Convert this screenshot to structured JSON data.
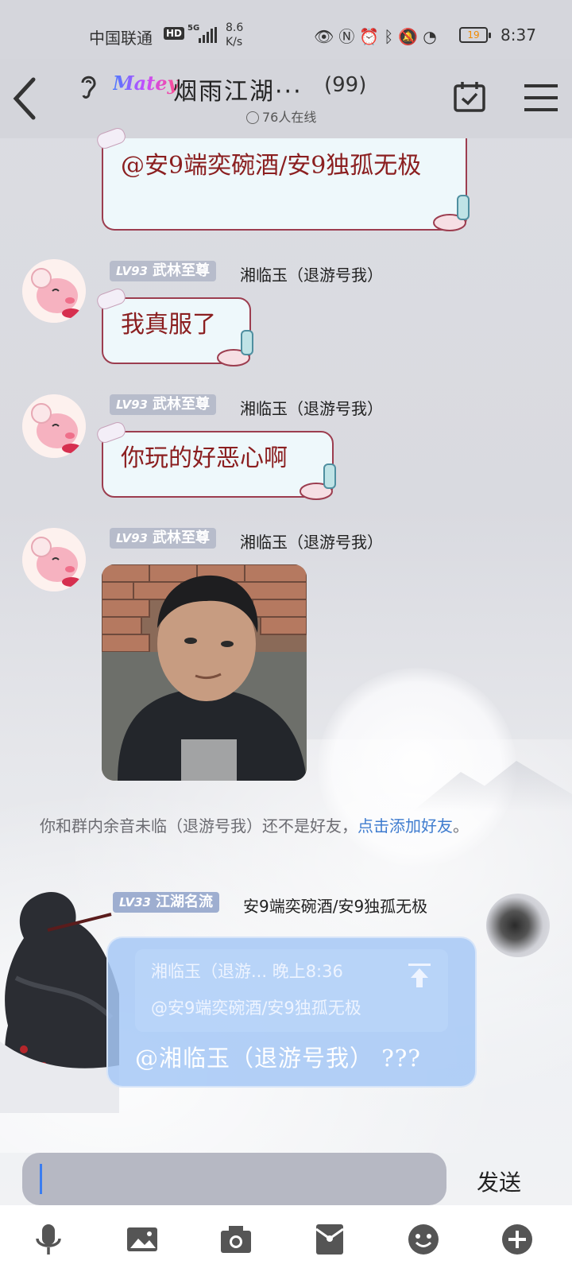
{
  "status_bar": {
    "carrier": "中国联通",
    "hd": "HD",
    "signal_label": "5G",
    "speed_value": "8.6",
    "speed_unit": "K/s",
    "battery": "19",
    "time": "8:37"
  },
  "header": {
    "logo_text": "Matey",
    "title": "烟雨江湖···",
    "member_count": "(99)",
    "online": "76人在线"
  },
  "messages": [
    {
      "text": "@安9端奕碗酒/安9独孤无极"
    },
    {
      "level": "LV93",
      "rank": "武林至尊",
      "sender": "湘临玉（退游号我）",
      "text": "我真服了"
    },
    {
      "level": "LV93",
      "rank": "武林至尊",
      "sender": "湘临玉（退游号我）",
      "text": "你玩的好恶心啊"
    },
    {
      "level": "LV93",
      "rank": "武林至尊",
      "sender": "湘临玉（退游号我）"
    }
  ],
  "system_notice": {
    "text": "你和群内余音未临（退游号我）还不是好友，",
    "link": "点击添加好友",
    "end": "。"
  },
  "own_message": {
    "level": "LV33",
    "rank": "江湖名流",
    "sender": "安9端奕碗酒/安9独孤无极",
    "quote_header": "湘临玉（退游... 晚上8:36",
    "quote_text": "@安9端奕碗酒/安9独孤无极",
    "text": "@湘临玉（退游号我） ???"
  },
  "input": {
    "placeholder": "",
    "send_label": "发送"
  },
  "toolbar": {
    "icons": [
      "microphone-icon",
      "image-icon",
      "camera-icon",
      "red-packet-icon",
      "emoji-icon",
      "plus-icon"
    ]
  },
  "colors": {
    "bubble_text": "#8b1f20",
    "bubble_border": "#9c3d4f",
    "link": "#3f7ccf",
    "own_bubble": "#a6c8f6",
    "caret": "#3b7df0"
  }
}
